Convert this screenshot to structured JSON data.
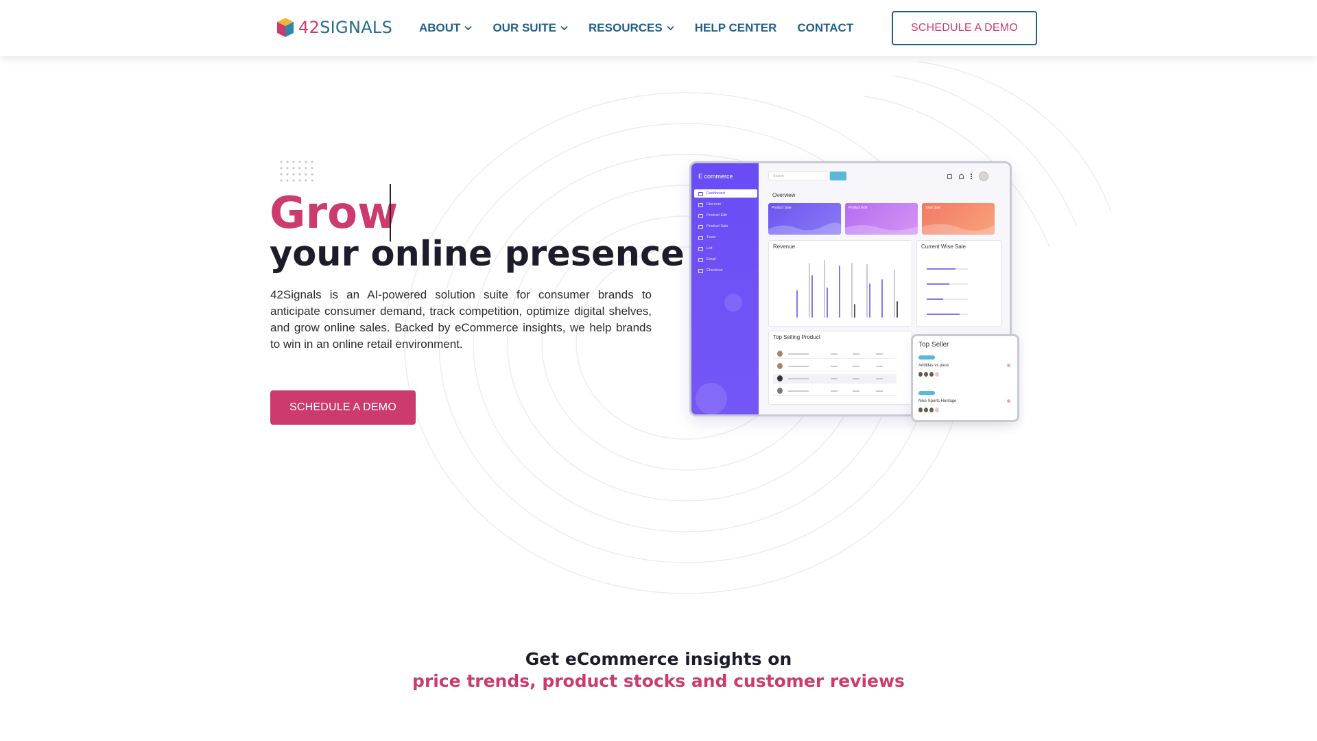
{
  "header": {
    "logo_prefix": "42",
    "logo_suffix": "SIGNALS",
    "nav": [
      {
        "label": "ABOUT",
        "icon": "chevron-down-icon"
      },
      {
        "label": "OUR SUITE",
        "icon": "chevron-down-icon"
      },
      {
        "label": "RESOURCES",
        "icon": "chevron-down-icon"
      },
      {
        "label": "HELP CENTER"
      },
      {
        "label": "CONTACT"
      }
    ],
    "cta_label": "SCHEDULE A DEMO"
  },
  "hero": {
    "title_highlight": "Grow",
    "title_rest": "your online presence",
    "description": "42Signals is an AI-powered solution suite for consumer brands to anticipate consumer demand, track competition, optimize digital shelves, and grow online sales. Backed by eCommerce insights, we help brands to win in an online retail environment.",
    "cta_label": "SCHEDULE A DEMO"
  },
  "dashboard": {
    "sidebar_title": "E commerce",
    "sidebar_items": [
      "Dashboard",
      "Discover",
      "Product Edit",
      "Product Sale",
      "Team",
      "List",
      "Email",
      "Checkout"
    ],
    "search_placeholder": "Search",
    "overview_label": "Overview",
    "cards": [
      {
        "label": "Product Sale",
        "color": "#6a56f0"
      },
      {
        "label": "Product Edit",
        "color": "#c27cf2"
      },
      {
        "label": "Total Sale",
        "color": "#f58b6c"
      }
    ],
    "revenue_title": "Revenue",
    "current_sale_title": "Current Wise Sale",
    "top_selling_title": "Top Selling Product",
    "top_seller": {
      "title": "Top Seller",
      "sellers": [
        "Addidas vs pace",
        "Nike Sports Heritage"
      ]
    }
  },
  "section": {
    "heading": "Get eCommerce insights on",
    "highlight": "price trends, product stocks and customer reviews"
  },
  "colors": {
    "brand_pink": "#cc3a6e",
    "brand_blue": "#1f5f8c",
    "dashboard_purple": "#6a4cf5"
  }
}
